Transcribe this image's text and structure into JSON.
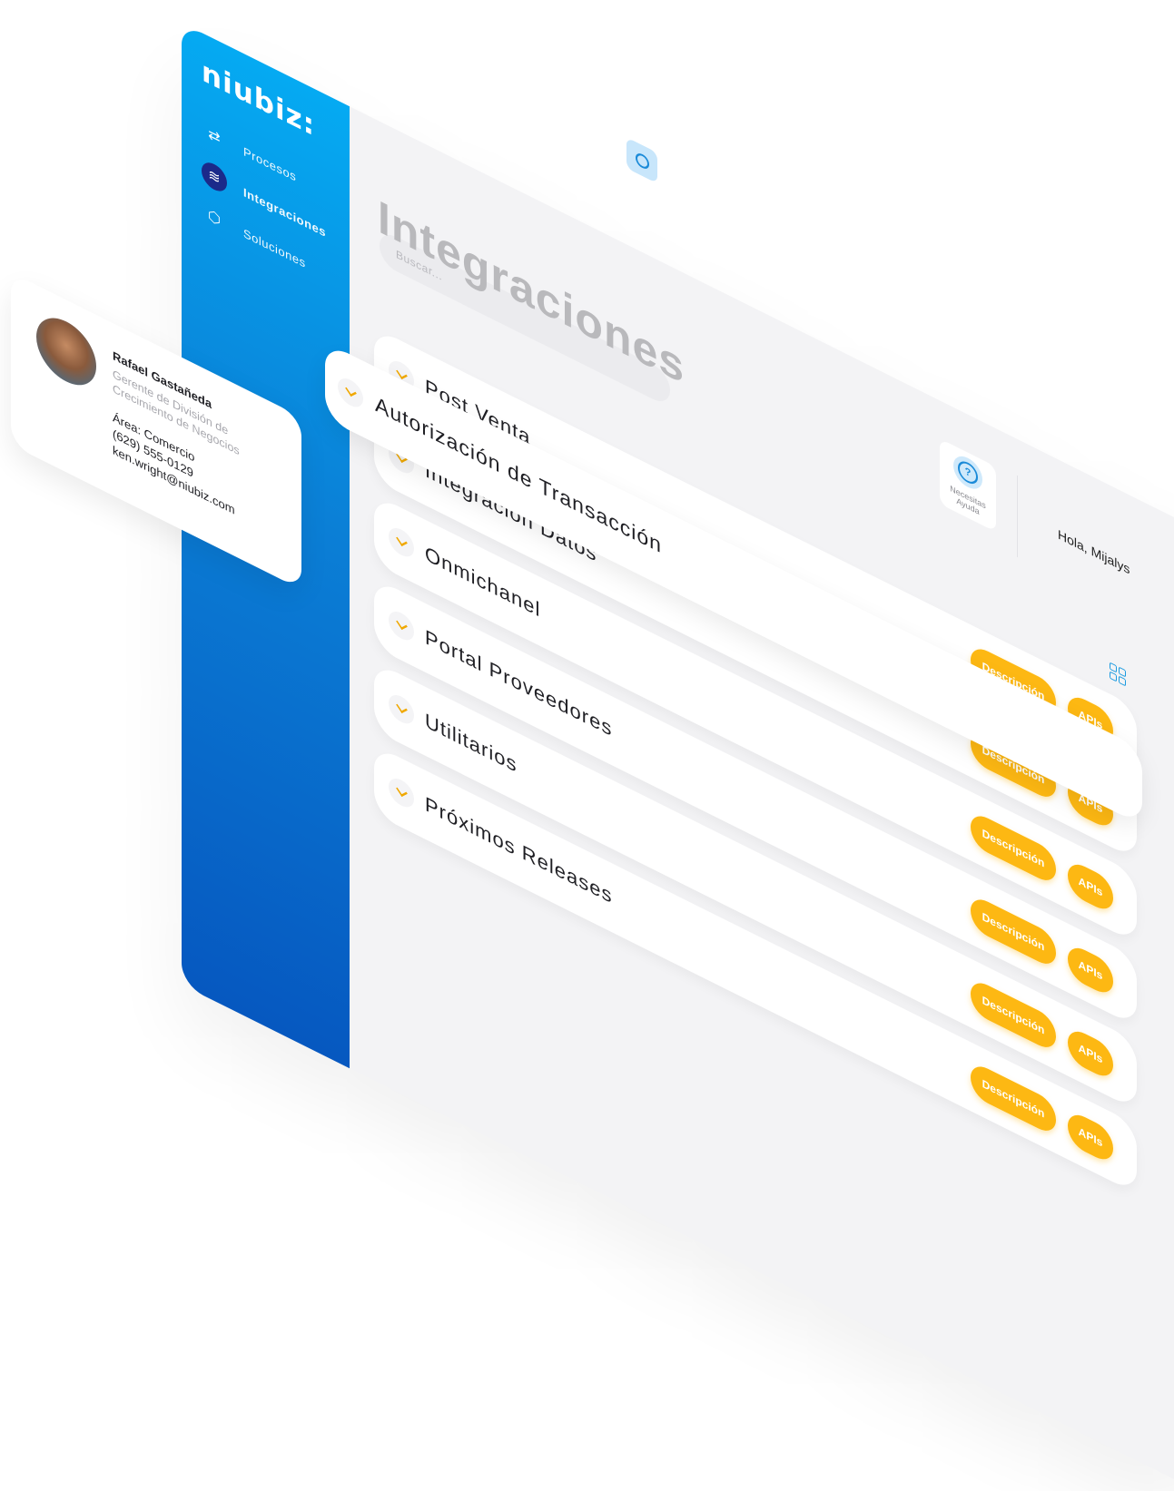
{
  "brand": {
    "logo": "niubiz:"
  },
  "sidebar": {
    "items": [
      {
        "label": "Procesos",
        "icon": "arrows-exchange-icon",
        "active": false
      },
      {
        "label": "Integraciones",
        "icon": "layers-icon",
        "active": true
      },
      {
        "label": "Soluciones",
        "icon": "box-icon",
        "active": false
      }
    ]
  },
  "header": {
    "search_placeholder": "Buscar...",
    "help_label": "Necesitas Ayuda",
    "greeting": "Hola, Mijalys"
  },
  "main": {
    "title": "Integraciones",
    "featured": {
      "label": "Autorización de Transacción"
    },
    "rows": [
      {
        "label": "Post Venta",
        "description_label": "Descripción",
        "apis_label": "APIs"
      },
      {
        "label": "Integración Datos",
        "description_label": "Descripción",
        "apis_label": "APIs"
      },
      {
        "label": "Onmichanel",
        "description_label": "Descripción",
        "apis_label": "APIs"
      },
      {
        "label": "Portal Proveedores",
        "description_label": "Descripción",
        "apis_label": "APIs"
      },
      {
        "label": "Utilitarios",
        "description_label": "Descripción",
        "apis_label": "APIs"
      },
      {
        "label": "Próximos Releases",
        "description_label": "Descripción",
        "apis_label": "APIs"
      }
    ]
  },
  "profile": {
    "name": "Rafael Gastañeda",
    "role": "Gerente de División de Crecimiento de Negocios",
    "area": "Área: Comercio",
    "phone": "(629) 555-0129",
    "email": "ken.wright@niubiz.com"
  },
  "colors": {
    "sidebar_top": "#05aaf2",
    "sidebar_bottom": "#0658c0",
    "accent_yellow": "#fdb813",
    "active_nav": "#1b2a8a",
    "icon_blue": "#1a8ad8"
  }
}
